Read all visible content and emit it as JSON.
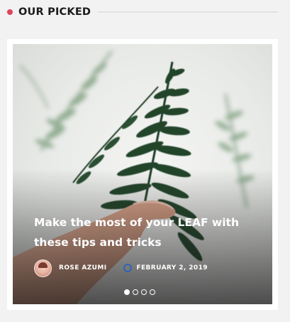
{
  "section": {
    "title": "OUR PICKED",
    "accent_color": "#e0445c"
  },
  "slider": {
    "post": {
      "title": "Make the most of your LEAF with these tips and tricks",
      "author": "ROSE AZUMI",
      "date": "FEBRUARY 2, 2019",
      "author_avatar_icon": "avatar",
      "date_icon": "clock-icon",
      "date_icon_color": "#2f64b0"
    },
    "pager": {
      "total": 4,
      "active_index": 0
    }
  }
}
